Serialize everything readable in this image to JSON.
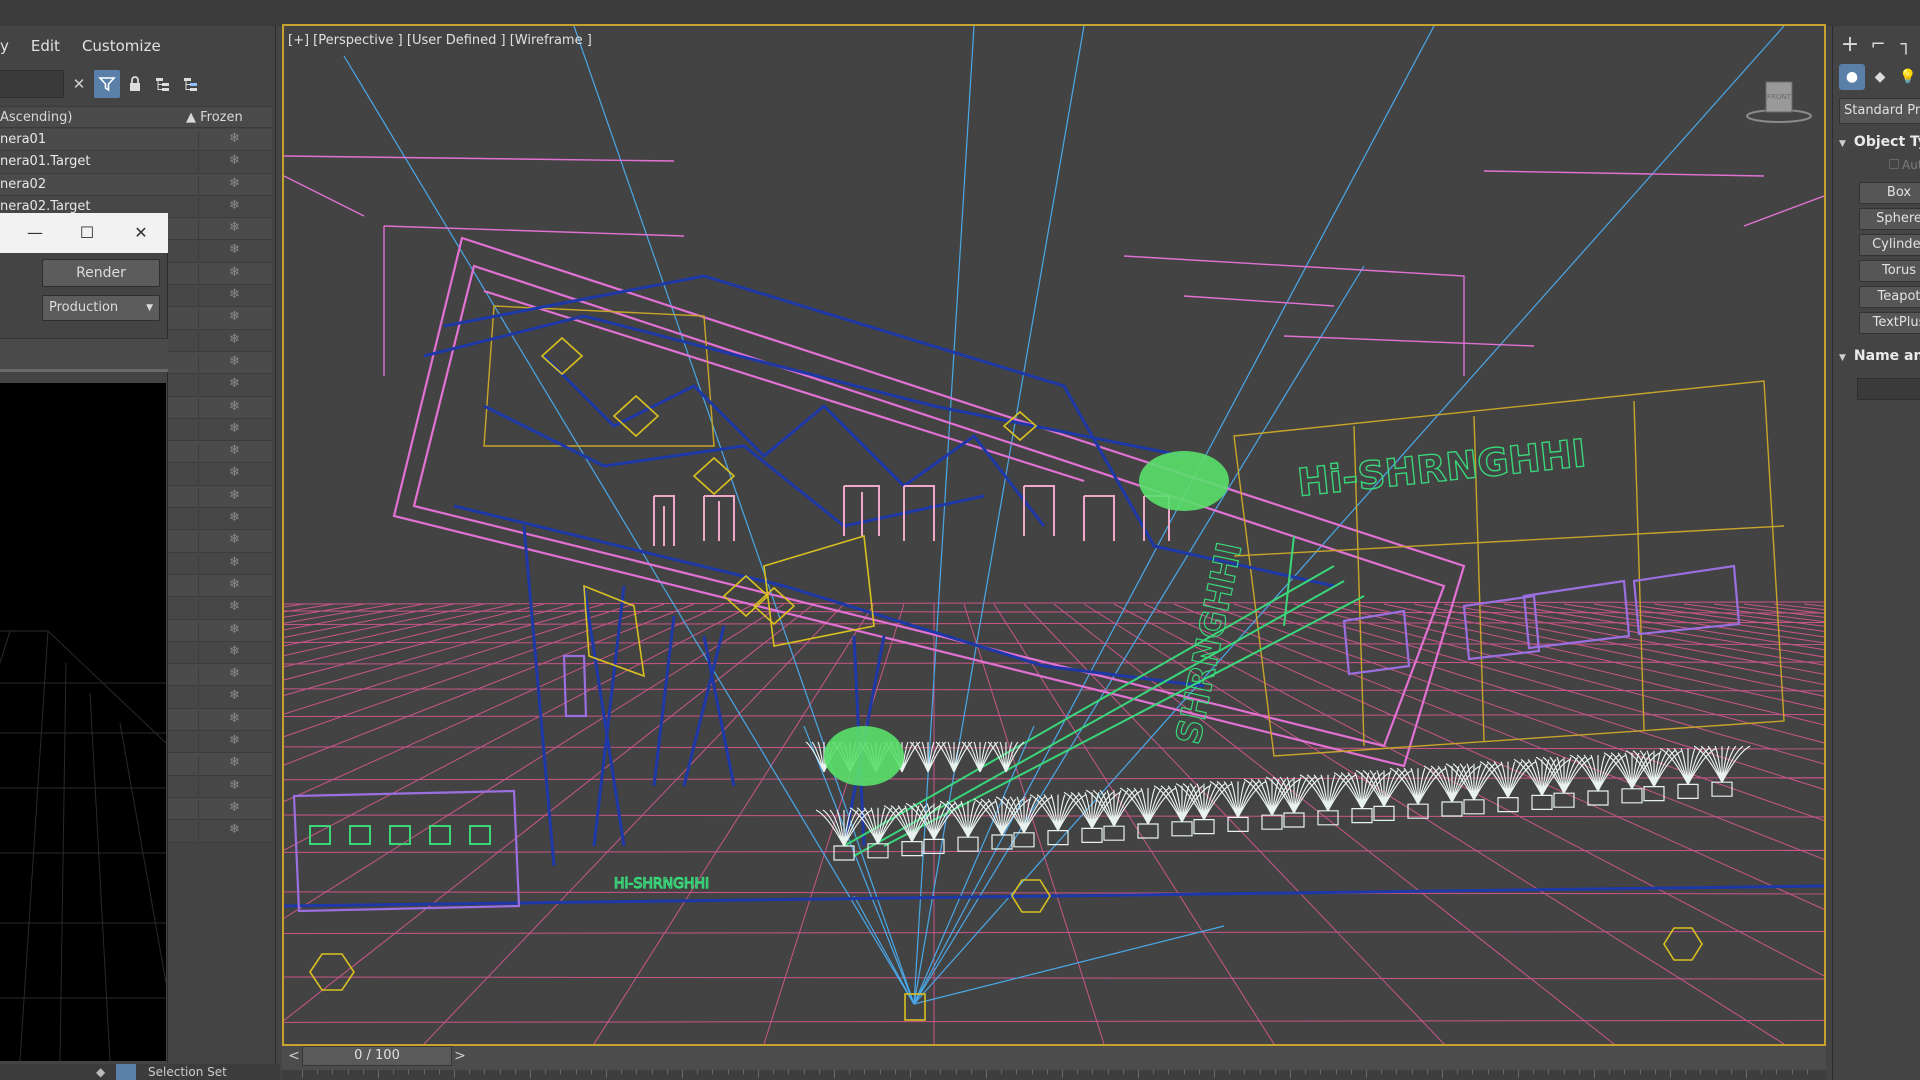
{
  "menubar": {
    "items": [
      "y",
      "Edit",
      "Customize"
    ]
  },
  "explorer": {
    "search_value": "",
    "column_name": "Ascending)",
    "column_frozen": "▲ Frozen",
    "rows": [
      "nera01",
      "nera01.Target",
      "nera02",
      "nera02.Target",
      "",
      "",
      "",
      "",
      "",
      "",
      "",
      "",
      "",
      "",
      "",
      "",
      "",
      "",
      "",
      "",
      "",
      "",
      "",
      "",
      "",
      "",
      "",
      "",
      "",
      "",
      "",
      ""
    ],
    "frozen_glyph": "❄"
  },
  "render_frame": {
    "minimize": "—",
    "maximize": "☐",
    "close": "✕",
    "render_label": "Render",
    "preset_value": "Production"
  },
  "bottom_left": {
    "selection_set": "Selection Set"
  },
  "viewport": {
    "label": "[+] [Perspective ] [User Defined ] [Wireframe ]",
    "sign_text": "Hi-SHRNGHHI",
    "sign_vertical_text": "SHRNGHHI",
    "floor_text": "Hi-SHRNGHHI",
    "viewcube_label": "FRONT",
    "colors": {
      "bg": "#434343",
      "grid": "#e05a95",
      "light": "#4aa8e8",
      "frame": "#e271d4",
      "struct": "#1e38a8",
      "gold": "#c8a52a",
      "green": "#3ad67a",
      "plant": "#e8f2ee",
      "chair": "#f0a8c8",
      "violet": "#9b6fe0"
    }
  },
  "timeline": {
    "prev": "<",
    "value": "0 / 100",
    "next": ">"
  },
  "command_panel": {
    "tabs": [
      "+",
      "⌐",
      "┐"
    ],
    "subtabs": [
      "●",
      "◆",
      "💡"
    ],
    "category": "Standard Primitives",
    "rollout_object_type": "Object Type",
    "autogrid": "AutoGrid",
    "buttons": [
      "Box",
      "Sphere",
      "Cylinder",
      "Torus",
      "Teapot",
      "TextPlus"
    ],
    "rollout_name": "Name and Color"
  }
}
